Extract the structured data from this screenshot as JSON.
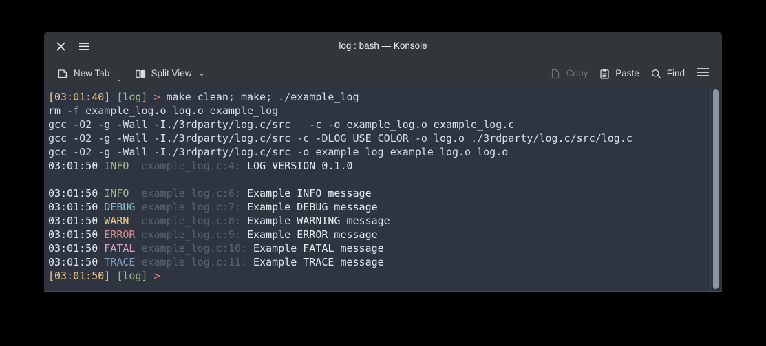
{
  "window": {
    "title": "log : bash — Konsole",
    "close_icon": "close-icon",
    "menu_icon": "hamburger-icon"
  },
  "toolbar": {
    "new_tab_label": "New Tab",
    "new_tab_icon": "new-tab-icon",
    "split_view_label": "Split View",
    "split_view_icon": "split-view-icon",
    "chevron_glyph": "⌄",
    "copy_label": "Copy",
    "copy_icon": "copy-icon",
    "copy_enabled": false,
    "paste_label": "Paste",
    "paste_icon": "paste-icon",
    "find_label": "Find",
    "find_icon": "search-icon",
    "menu_icon": "hamburger-icon"
  },
  "colors": {
    "window_chrome": "#31363b",
    "terminal_bg": "#2e3440",
    "terminal_fg": "#d8dee9",
    "yellow": "#ebcb8b",
    "green": "#a3be8c",
    "red": "#d98a8a",
    "cyan": "#88c0d0",
    "magenta": "#e0a0c0",
    "dim": "#5a6270",
    "blue": "#81a1c1",
    "scrollbar_thumb": "#8b96a5"
  },
  "terminal": {
    "scrollbar": {
      "thumb_top_pct": 1,
      "thumb_height_pct": 98
    },
    "lines": [
      {
        "id": "prompt-command",
        "spans": [
          {
            "text": "[03:01:40]",
            "color": "yellow"
          },
          {
            "text": " ",
            "color": "default"
          },
          {
            "text": "[log]",
            "color": "green"
          },
          {
            "text": " ",
            "color": "default"
          },
          {
            "text": ">",
            "color": "red"
          },
          {
            "text": " make clean; make; ./example_log",
            "color": "default"
          }
        ]
      },
      {
        "id": "rm-line",
        "spans": [
          {
            "text": "rm -f example_log.o log.o example_log",
            "color": "default"
          }
        ]
      },
      {
        "id": "gcc-line-1",
        "spans": [
          {
            "text": "gcc -O2 -g -Wall -I./3rdparty/log.c/src   -c -o example_log.o example_log.c",
            "color": "default"
          }
        ]
      },
      {
        "id": "gcc-line-2",
        "spans": [
          {
            "text": "gcc -O2 -g -Wall -I./3rdparty/log.c/src -c -DLOG_USE_COLOR -o log.o ./3rdparty/log.c/src/log.c",
            "color": "default"
          }
        ]
      },
      {
        "id": "gcc-line-3",
        "spans": [
          {
            "text": "gcc -O2 -g -Wall -I./3rdparty/log.c/src -o example_log example_log.o log.o",
            "color": "default"
          }
        ]
      },
      {
        "id": "log-version",
        "spans": [
          {
            "text": "03:01:50 ",
            "color": "white"
          },
          {
            "text": "INFO ",
            "color": "green"
          },
          {
            "text": " example_log.c:4: ",
            "color": "dim"
          },
          {
            "text": "LOG VERSION 0.1.0",
            "color": "white"
          }
        ]
      },
      {
        "id": "blank-line",
        "spans": [
          {
            "text": " ",
            "color": "default"
          }
        ]
      },
      {
        "id": "log-info",
        "spans": [
          {
            "text": "03:01:50 ",
            "color": "white"
          },
          {
            "text": "INFO ",
            "color": "green"
          },
          {
            "text": " example_log.c:6: ",
            "color": "dim"
          },
          {
            "text": "Example INFO message",
            "color": "white"
          }
        ]
      },
      {
        "id": "log-debug",
        "spans": [
          {
            "text": "03:01:50 ",
            "color": "white"
          },
          {
            "text": "DEBUG",
            "color": "cyan"
          },
          {
            "text": " example_log.c:7: ",
            "color": "dim"
          },
          {
            "text": "Example DEBUG message",
            "color": "white"
          }
        ]
      },
      {
        "id": "log-warn",
        "spans": [
          {
            "text": "03:01:50 ",
            "color": "white"
          },
          {
            "text": "WARN ",
            "color": "yellow"
          },
          {
            "text": " example_log.c:8: ",
            "color": "dim"
          },
          {
            "text": "Example WARNING message",
            "color": "white"
          }
        ]
      },
      {
        "id": "log-error",
        "spans": [
          {
            "text": "03:01:50 ",
            "color": "white"
          },
          {
            "text": "ERROR",
            "color": "red"
          },
          {
            "text": " example_log.c:9: ",
            "color": "dim"
          },
          {
            "text": "Example ERROR message",
            "color": "white"
          }
        ]
      },
      {
        "id": "log-fatal",
        "spans": [
          {
            "text": "03:01:50 ",
            "color": "white"
          },
          {
            "text": "FATAL",
            "color": "magenta"
          },
          {
            "text": " example_log.c:10: ",
            "color": "dim"
          },
          {
            "text": "Example FATAL message",
            "color": "white"
          }
        ]
      },
      {
        "id": "log-trace",
        "spans": [
          {
            "text": "03:01:50 ",
            "color": "white"
          },
          {
            "text": "TRACE",
            "color": "blue"
          },
          {
            "text": " example_log.c:11: ",
            "color": "dim"
          },
          {
            "text": "Example TRACE message",
            "color": "white"
          }
        ]
      },
      {
        "id": "prompt-final",
        "spans": [
          {
            "text": "[03:01:50]",
            "color": "yellow"
          },
          {
            "text": " ",
            "color": "default"
          },
          {
            "text": "[log]",
            "color": "green"
          },
          {
            "text": " ",
            "color": "default"
          },
          {
            "text": ">",
            "color": "red"
          },
          {
            "text": " ",
            "color": "default"
          }
        ]
      }
    ]
  }
}
